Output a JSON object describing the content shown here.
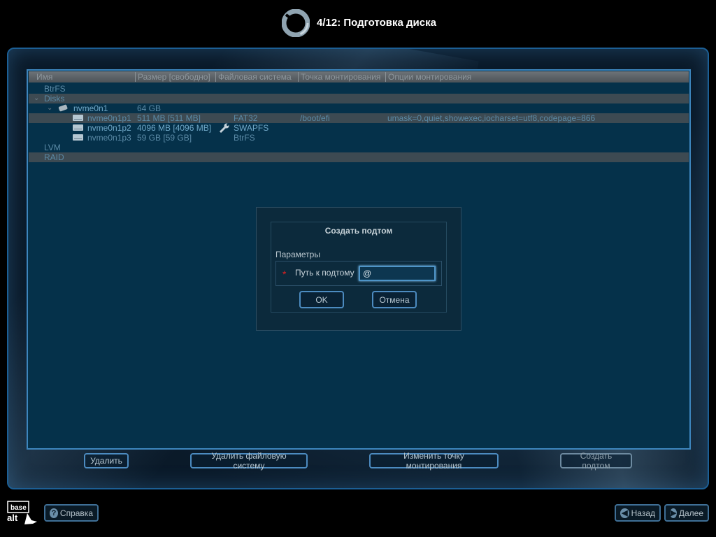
{
  "header": {
    "step": "4/12: Подготовка диска"
  },
  "table": {
    "columns": [
      "Имя",
      "Размер [свободно]",
      "Файловая система",
      "Точка монтирования",
      "Опции монтирования"
    ],
    "rows": [
      {
        "name": "BtrFS"
      },
      {
        "name": "Disks"
      },
      {
        "name": "nvme0n1",
        "size": "64 GB"
      },
      {
        "name": "nvme0n1p1",
        "size": "511 MB [511 MB]",
        "fs": "FAT32",
        "mount": "/boot/efi",
        "options": "umask=0,quiet,showexec,iocharset=utf8,codepage=866"
      },
      {
        "name": "nvme0n1p2",
        "size": "4096 MB [4096 MB]",
        "fs": "SWAPFS"
      },
      {
        "name": "nvme0n1p3",
        "size": "59 GB [59 GB]",
        "fs": "BtrFS"
      },
      {
        "name": "LVM"
      },
      {
        "name": "RAID"
      }
    ]
  },
  "actions": {
    "delete": "Удалить",
    "delete_fs": "Удалить файловую систему",
    "change_mount": "Изменить точку монтирования",
    "create_subvol": "Создать подтом"
  },
  "dialog": {
    "title": "Создать подтом",
    "group": "Параметры",
    "field_label": "Путь к подтому",
    "field_value": "@",
    "ok": "OK",
    "cancel": "Отмена"
  },
  "footer": {
    "help": "Справка",
    "back": "Назад",
    "next": "Далее",
    "brand_top": "base",
    "brand_bottom": "alt"
  }
}
